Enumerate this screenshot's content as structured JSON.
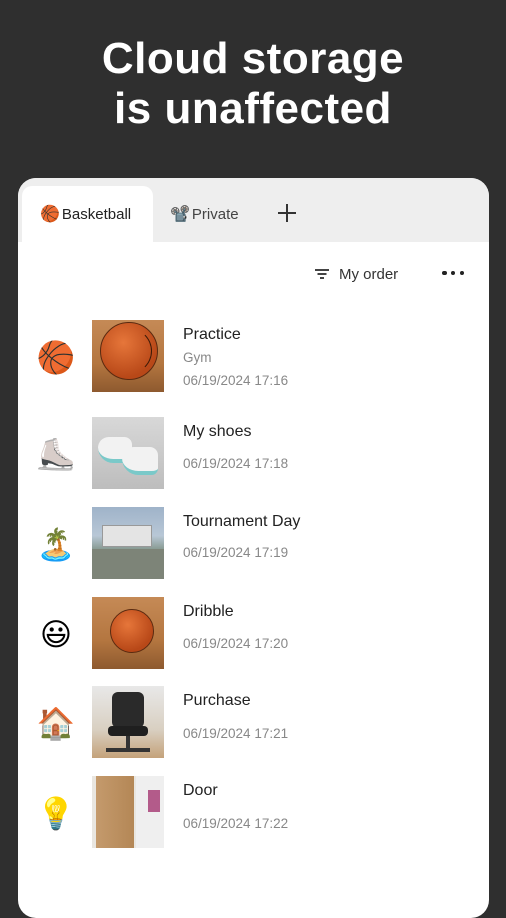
{
  "headline": {
    "line1": "Cloud storage",
    "line2": "is unaffected"
  },
  "tabs": [
    {
      "emoji": "🏀",
      "label": "Basketball",
      "active": true
    },
    {
      "emoji": "📽️",
      "label": "Private",
      "active": false
    }
  ],
  "sort": {
    "label": "My order"
  },
  "items": [
    {
      "emoji": "🏀",
      "title": "Practice",
      "subtitle": "Gym",
      "date": "06/19/2024 17:16"
    },
    {
      "emoji": "⛸️",
      "title": "My shoes",
      "subtitle": "",
      "date": "06/19/2024 17:18"
    },
    {
      "emoji": "🏝️",
      "title": "Tournament Day",
      "subtitle": "",
      "date": "06/19/2024 17:19"
    },
    {
      "emoji": "😃",
      "title": "Dribble",
      "subtitle": "",
      "date": "06/19/2024 17:20"
    },
    {
      "emoji": "🏠",
      "title": "Purchase",
      "subtitle": "",
      "date": "06/19/2024 17:21"
    },
    {
      "emoji": "💡",
      "title": "Door",
      "subtitle": "",
      "date": "06/19/2024 17:22"
    }
  ],
  "colors": {
    "background": "#2f2f2f",
    "card": "#ffffff",
    "tabbar": "#eeeeee",
    "text": "#222222",
    "muted": "#888888"
  },
  "icons": [
    "filter-icon",
    "more-icon",
    "add-tab-icon"
  ]
}
